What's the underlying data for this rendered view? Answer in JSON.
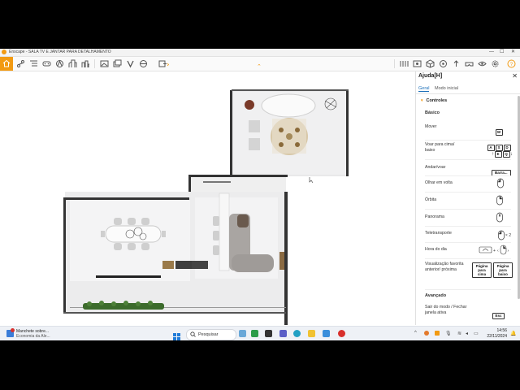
{
  "window": {
    "title": "Enscape - SALA TV E JANTAR PARA DETALHAMENTO"
  },
  "toolbar": {
    "home_icon": "home-icon",
    "collapse_icon": "chevron-up-icon",
    "accent": "#f29a12"
  },
  "help_panel": {
    "title": "Ajuda[H]",
    "tabs": [
      {
        "label": "Geral",
        "active": true
      },
      {
        "label": "Modo inicial",
        "active": false
      }
    ],
    "section_controls": "Controles",
    "subsection_basic": "Básico",
    "rows": [
      {
        "label": "Mover",
        "keys": [
          "W",
          "A",
          "S",
          "D"
        ]
      },
      {
        "label": "Voar para cima/ baixo",
        "keys": [
          "E",
          "Q"
        ]
      },
      {
        "label": "Andar/voar",
        "keys": [
          "Barra..."
        ]
      },
      {
        "label": "Olhar em volta",
        "icon": "mouse-left-icon"
      },
      {
        "label": "Órbita",
        "icon": "mouse-right-icon"
      },
      {
        "label": "Panorama",
        "icon": "mouse-middle-icon"
      },
      {
        "label": "Teletransporte",
        "icon": "mouse-double-icon",
        "suffix": "× 2"
      },
      {
        "label": "Hora do dia",
        "icon": "time-of-day-icon"
      },
      {
        "label": "Visualização favorita anterior/ próxima",
        "keys": [
          "Página para cima",
          "Página para baixo"
        ]
      }
    ],
    "subsection_advanced": "Avançado",
    "advanced_rows": [
      {
        "label": "Sair do modo / Fechar janela ativa",
        "keys": [
          "Esc"
        ]
      }
    ]
  },
  "taskbar": {
    "news_title": "Manchete sobre...",
    "news_subtitle": "Economia da Ale...",
    "search_placeholder": "Pesquisar",
    "time": "14:56",
    "date": "22/11/2024"
  }
}
